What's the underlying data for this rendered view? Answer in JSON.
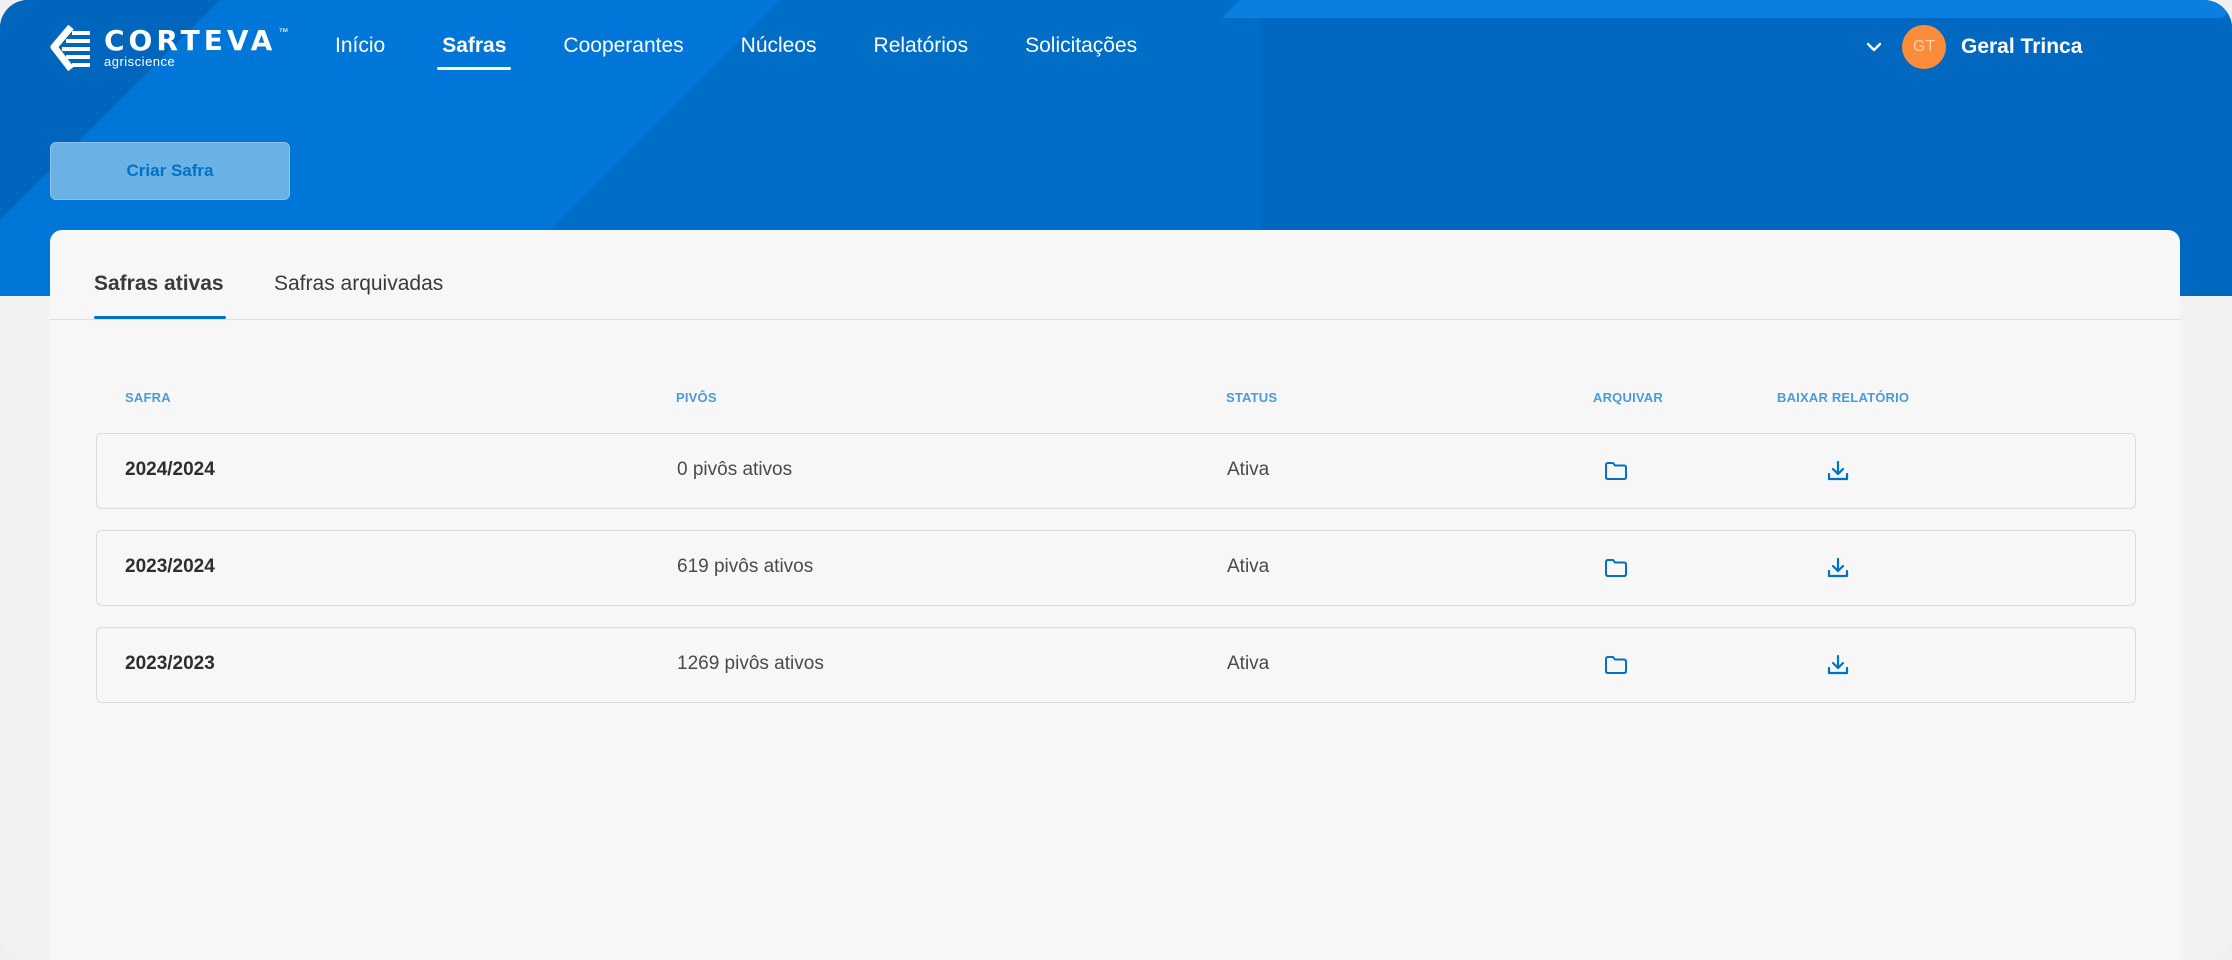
{
  "brand": {
    "name": "CORTEVA",
    "tagline": "agriscience",
    "trademark": "™"
  },
  "nav": {
    "items": [
      {
        "label": "Início"
      },
      {
        "label": "Safras"
      },
      {
        "label": "Cooperantes"
      },
      {
        "label": "Núcleos"
      },
      {
        "label": "Relatórios"
      },
      {
        "label": "Solicitações"
      }
    ],
    "active": "Safras"
  },
  "user": {
    "initials": "GT",
    "name": "Geral Trinca"
  },
  "actions": {
    "create_label": "Criar Safra"
  },
  "tabs": {
    "active": "Safras ativas",
    "archived": "Safras arquivadas"
  },
  "table": {
    "columns": [
      "SAFRA",
      "PIVÔS",
      "STATUS",
      "ARQUIVAR",
      "BAIXAR RELATÓRIO"
    ],
    "rows": [
      {
        "safra": "2024/2024",
        "pivos": "0 pivôs ativos",
        "status": "Ativa"
      },
      {
        "safra": "2023/2024",
        "pivos": "619 pivôs ativos",
        "status": "Ativa"
      },
      {
        "safra": "2023/2023",
        "pivos": "1269 pivôs ativos",
        "status": "Ativa"
      }
    ]
  },
  "icons": {
    "archive": "folder-icon",
    "download": "download-icon",
    "dropdown": "chevron-down-icon"
  },
  "colors": {
    "header": "#006ec7",
    "accent": "#0072c6",
    "avatar": "#fb8c3c",
    "column_header": "#4a9bdc"
  }
}
